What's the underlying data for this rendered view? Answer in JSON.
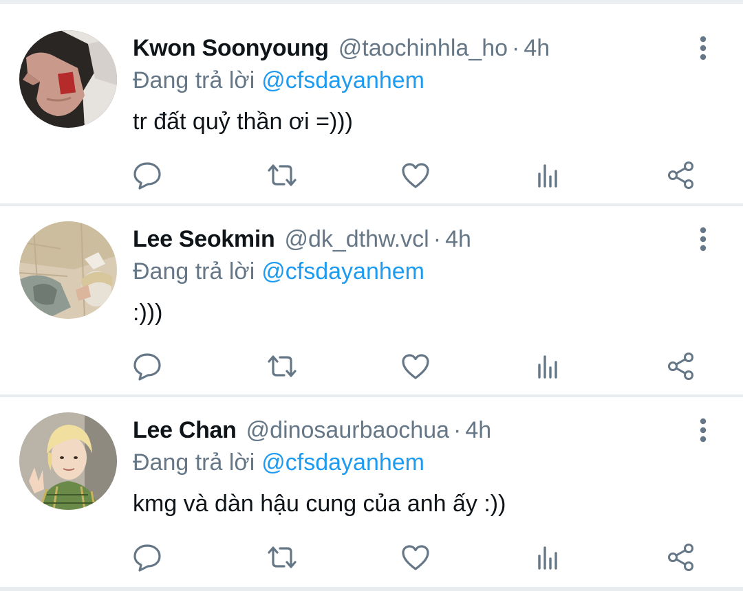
{
  "icons": {
    "reply": "comment-bubble-icon",
    "retweet": "retweet-arrows-icon",
    "like": "heart-icon",
    "analytics": "bar-chart-icon",
    "share": "share-nodes-icon",
    "more": "vertical-ellipsis-icon"
  },
  "colors": {
    "text": "#0f1419",
    "secondary": "#657786",
    "mention": "#1d9bf0",
    "icon": "#657786",
    "divider": "#e9ecee"
  },
  "tweets": [
    {
      "name": "Kwon Soonyoung",
      "handle": "@taochinhla_ho",
      "separator": "·",
      "time": "4h",
      "replying_label": "Đang trả lời",
      "replying_to": "@cfsdayanhem",
      "text": "tr đất quỷ thần ơi =)))"
    },
    {
      "name": "Lee Seokmin",
      "handle": "@dk_dthw.vcl",
      "separator": "·",
      "time": "4h",
      "replying_label": "Đang trả lời",
      "replying_to": "@cfsdayanhem",
      "text": ":)))"
    },
    {
      "name": "Lee Chan",
      "handle": "@dinosaurbaochua",
      "separator": "·",
      "time": "4h",
      "replying_label": "Đang trả lời",
      "replying_to": "@cfsdayanhem",
      "text": "kmg và dàn hậu cung của anh ấy :))"
    }
  ]
}
